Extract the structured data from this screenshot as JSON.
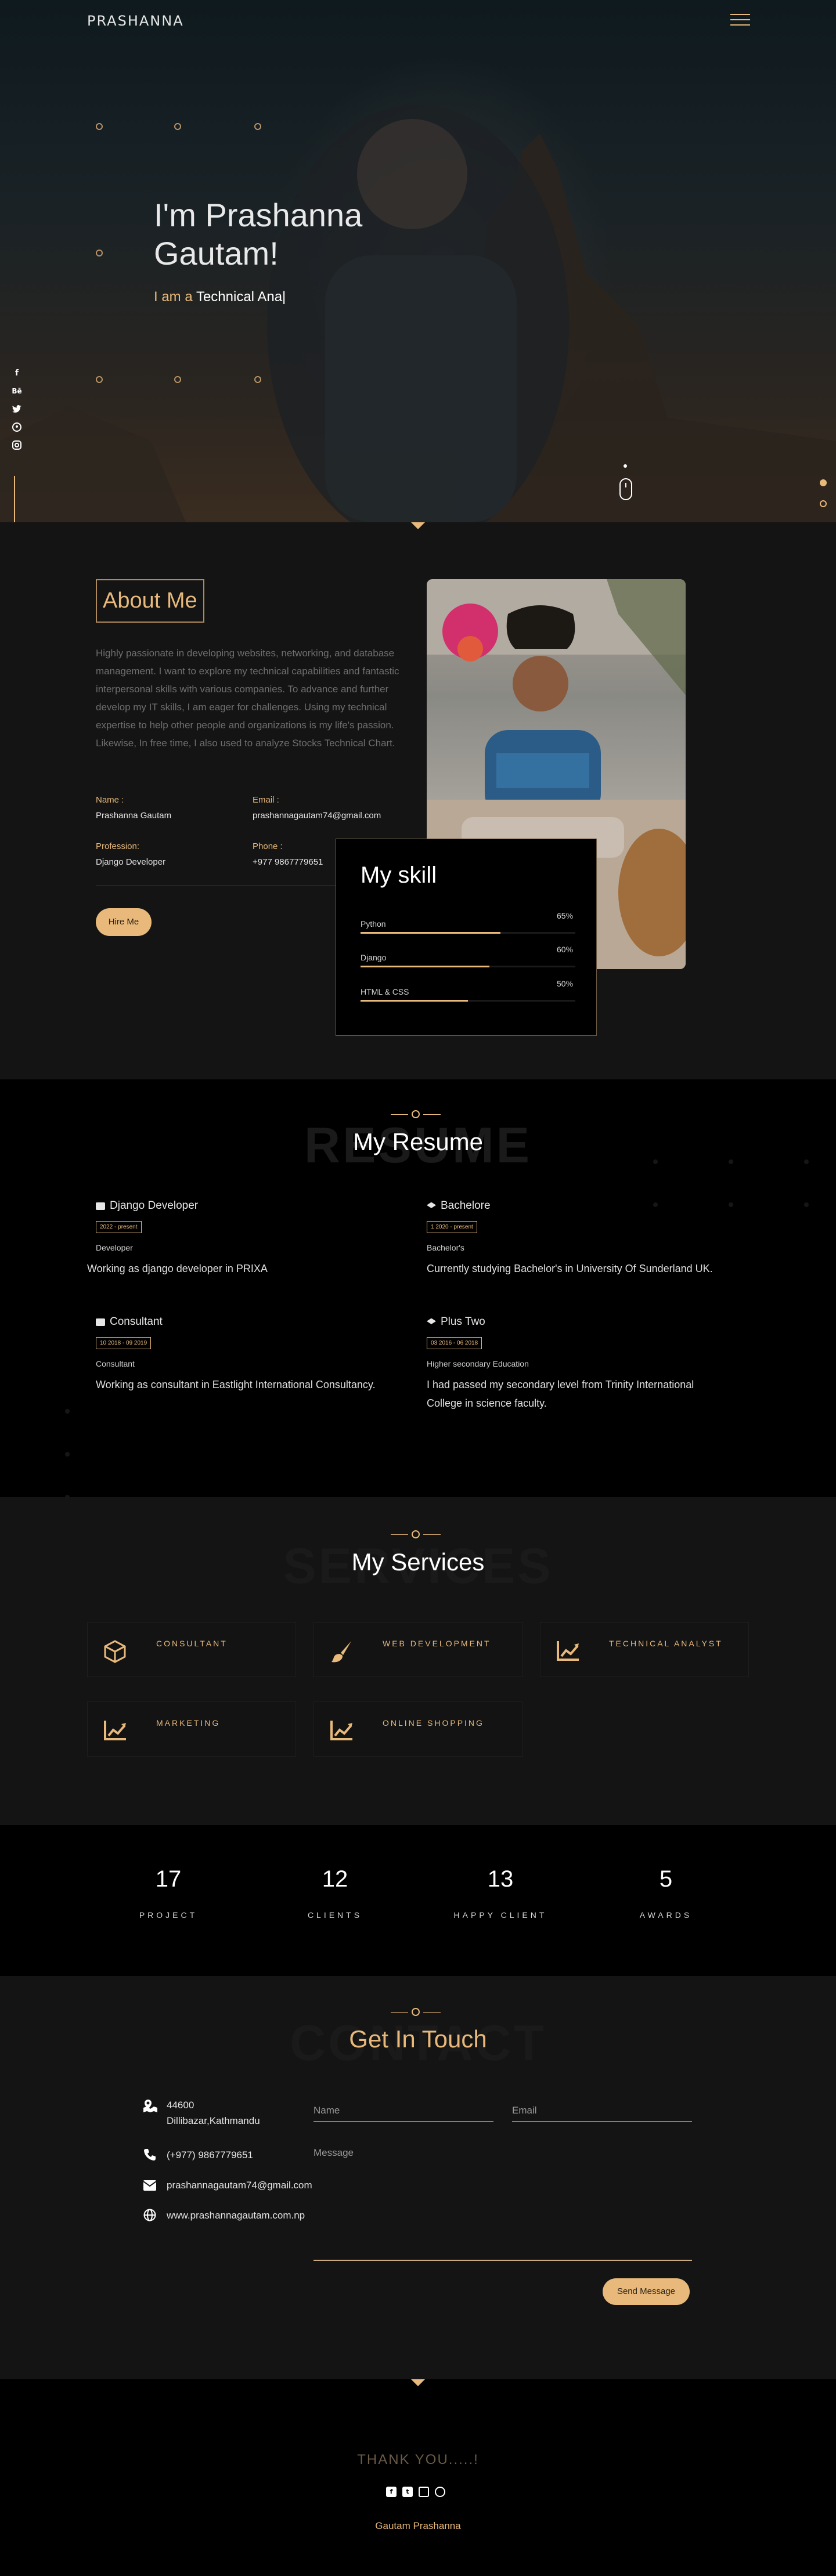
{
  "brand": "PRASHANNA",
  "hero": {
    "title_line1": "I'm Prashanna",
    "title_line2": "Gautam!",
    "sub_prefix": "I am a ",
    "sub_typed": "Technical Ana|"
  },
  "about": {
    "heading": "About Me",
    "paragraph": "Highly passionate in developing websites, networking, and database management. I want to explore my technical capabilities and fantastic interpersonal skills with various companies. To advance and further develop my IT skills, I am eager for challenges. Using my technical expertise to help other people and organizations is my life's passion. Likewise, In free time, I also used to analyze Stocks Technical Chart.",
    "name_label": "Name :",
    "name_value": "Prashanna Gautam",
    "email_label": "Email :",
    "email_value": "prashannagautam74@gmail.com",
    "profession_label": "Profession:",
    "profession_value": "Django Developer",
    "phone_label": "Phone :",
    "phone_value": "+977 9867779651",
    "hire_button": "Hire Me"
  },
  "skills": {
    "title": "My skill",
    "items": [
      {
        "name": "Python",
        "percent_label": "65%",
        "value": 65
      },
      {
        "name": "Django",
        "percent_label": "60%",
        "value": 60
      },
      {
        "name": "HTML & CSS",
        "percent_label": "50%",
        "value": 50
      }
    ]
  },
  "resume": {
    "ghost": "RESUME",
    "title": "My Resume",
    "entries": [
      {
        "title": "Django Developer",
        "date": "2022 - present",
        "role": "Developer",
        "desc": "Working as django developer in PRIXA"
      },
      {
        "title": "Bachelore",
        "date": "1 2020 - present",
        "role": "Bachelor's",
        "desc": "Currently studying Bachelor's in University Of Sunderland UK."
      },
      {
        "title": "Consultant",
        "date": "10 2018 - 09 2019",
        "role": "Consultant",
        "desc": "Working as consultant in Eastlight International Consultancy."
      },
      {
        "title": "Plus Two",
        "date": "03 2016 - 06 2018",
        "role": "Higher secondary Education",
        "desc": "I had passed my secondary level from Trinity International College in science faculty."
      }
    ]
  },
  "services": {
    "ghost": "SERVICES",
    "title": "My Services",
    "items": [
      {
        "label": "CONSULTANT",
        "icon": "cube-icon"
      },
      {
        "label": "WEB DEVELOPMENT",
        "icon": "paint-brush-icon"
      },
      {
        "label": "TECHNICAL ANALYST",
        "icon": "chart-line-icon"
      },
      {
        "label": "MARKETING",
        "icon": "chart-line-icon"
      },
      {
        "label": "ONLINE SHOPPING",
        "icon": "chart-line-icon"
      }
    ]
  },
  "stats": [
    {
      "number": "17",
      "label": "PROJECT"
    },
    {
      "number": "12",
      "label": "CLIENTS"
    },
    {
      "number": "13",
      "label": "HAPPY CLIENT"
    },
    {
      "number": "5",
      "label": "AWARDS"
    }
  ],
  "contact": {
    "ghost": "CONTACT",
    "title": "Get In Touch",
    "postal": "44600",
    "address": "Dillibazar,Kathmandu",
    "phone": "(+977) 9867779651",
    "email": "prashannagautam74@gmail.com",
    "website": "www.prashannagautam.com.np",
    "name_placeholder": "Name",
    "email_placeholder": "Email",
    "message_placeholder": "Message",
    "send_button": "Send Message"
  },
  "footer": {
    "title": "THANK YOU.....!",
    "name": "Gautam Prashanna"
  },
  "colors": {
    "accent": "#e8b97a",
    "background": "#141414",
    "dark": "#000000"
  }
}
